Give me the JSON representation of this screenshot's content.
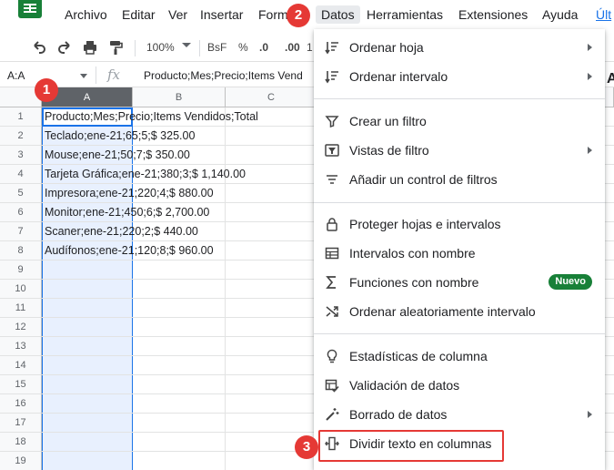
{
  "menubar": {
    "items": [
      "Archivo",
      "Editar",
      "Ver",
      "Insertar",
      "Form",
      "Datos",
      "Herramientas",
      "Extensiones",
      "Ayuda",
      "Últ"
    ]
  },
  "toolbar": {
    "zoom": "100%",
    "currency": "BsF",
    "percent": "%",
    "dec_decrease": ".0",
    "dec_increase": ".00",
    "number_format": "1",
    "overflow_letter": "A"
  },
  "formula_bar": {
    "name_box": "A:A",
    "fx": "fx",
    "content": "Producto;Mes;Precio;Items Vend"
  },
  "sheet": {
    "columns": [
      "A",
      "B",
      "C"
    ],
    "rows": [
      "1",
      "2",
      "3",
      "4",
      "5",
      "6",
      "7",
      "8",
      "9",
      "10",
      "11",
      "12",
      "13",
      "14",
      "15",
      "16",
      "17",
      "18",
      "19"
    ],
    "cells": [
      "Producto;Mes;Precio;Items Vendidos;Total",
      "Teclado;ene-21;65;5;$ 325.00",
      "Mouse;ene-21;50;7;$ 350.00",
      "Tarjeta Gráfica;ene-21;380;3;$ 1,140.00",
      "Impresora;ene-21;220;4;$ 880.00",
      "Monitor;ene-21;450;6;$ 2,700.00",
      "Scaner;ene-21;220;2;$ 440.00",
      "Audífonos;ene-21;120;8;$ 960.00"
    ]
  },
  "badges": [
    "1",
    "2",
    "3"
  ],
  "datos_menu": {
    "items": [
      {
        "label": "Ordenar hoja",
        "icon": "sort-icon",
        "submenu": true
      },
      {
        "label": "Ordenar intervalo",
        "icon": "sort-icon",
        "submenu": true
      },
      {
        "label": "Crear un filtro",
        "icon": "filter-icon",
        "submenu": false
      },
      {
        "label": "Vistas de filtro",
        "icon": "filter-views-icon",
        "submenu": true
      },
      {
        "label": "Añadir un control de filtros",
        "icon": "slicer-icon",
        "submenu": false
      },
      {
        "label": "Proteger hojas e intervalos",
        "icon": "lock-icon",
        "submenu": false
      },
      {
        "label": "Intervalos con nombre",
        "icon": "named-ranges-icon",
        "submenu": false
      },
      {
        "label": "Funciones con nombre",
        "icon": "sigma-icon",
        "submenu": false,
        "badge": "Nuevo"
      },
      {
        "label": "Ordenar aleatoriamente intervalo",
        "icon": "shuffle-icon",
        "submenu": false
      },
      {
        "label": "Estadísticas de columna",
        "icon": "lightbulb-icon",
        "submenu": false
      },
      {
        "label": "Validación de datos",
        "icon": "data-validation-icon",
        "submenu": false
      },
      {
        "label": "Borrado de datos",
        "icon": "magic-wand-icon",
        "submenu": true
      },
      {
        "label": "Dividir texto en columnas",
        "icon": "split-columns-icon",
        "submenu": false
      }
    ]
  },
  "colors": {
    "accent": "#1a73e8",
    "badge_red": "#e53935",
    "sheets_green": "#188038",
    "column_selection": "#e8f0fe"
  }
}
